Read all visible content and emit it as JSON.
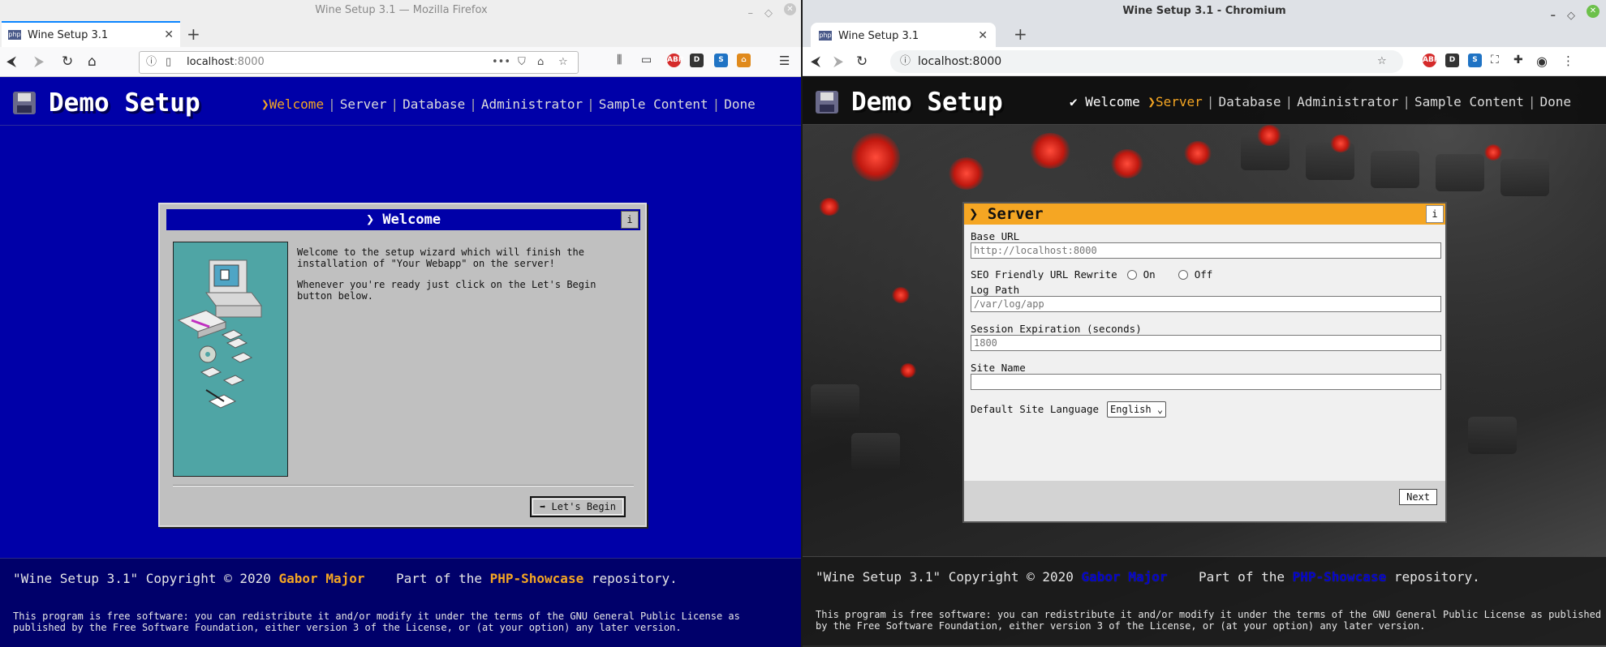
{
  "firefox": {
    "window_title": "Wine Setup 3.1 — Mozilla Firefox",
    "tab_title": "Wine Setup 3.1",
    "favicon_text": "php",
    "url_host": "localhost",
    "url_port": ":8000"
  },
  "chromium": {
    "window_title": "Wine Setup 3.1 - Chromium",
    "tab_title": "Wine Setup 3.1",
    "favicon_text": "php",
    "url": "localhost:8000"
  },
  "app": {
    "logo_text": "Demo Setup",
    "steps": [
      "Welcome",
      "Server",
      "Database",
      "Administrator",
      "Sample Content",
      "Done"
    ],
    "step_arrow": "❯",
    "step_done_mark": "✔"
  },
  "welcome_dialog": {
    "title": "❯ Welcome",
    "info_label": "i",
    "paragraph1": "Welcome to the setup wizard which will finish the installation of \"Your Webapp\" on the server!",
    "paragraph2": "Whenever you're ready just click on the Let's Begin button below.",
    "begin_button": "➡ Let's Begin"
  },
  "server_dialog": {
    "title": "❯ Server",
    "info_label": "i",
    "base_url_label": "Base URL",
    "base_url_placeholder": "http://localhost:8000",
    "seo_label": "SEO Friendly URL Rewrite",
    "seo_on": "On",
    "seo_off": "Off",
    "log_path_label": "Log Path",
    "log_path_placeholder": "/var/log/app",
    "session_label": "Session Expiration (seconds)",
    "session_placeholder": "1800",
    "site_name_label": "Site Name",
    "site_name_value": "",
    "language_label": "Default Site Language",
    "language_value": "English",
    "next_button": "Next"
  },
  "footer": {
    "prefix": "\"Wine Setup 3.1\" Copyright © 2020 ",
    "author": "Gabor Major",
    "part_of": "Part of the ",
    "repo": "PHP-Showcase",
    "suffix": " repository.",
    "license": "This program is free software: you can redistribute it and/or modify it under the terms of the GNU General Public License as published by the Free Software Foundation, either version 3 of the License, or (at your option) any later version."
  },
  "colors": {
    "left_bg": "#0000a8",
    "accent": "#f5a623",
    "server_title_bg": "#f5a623"
  }
}
